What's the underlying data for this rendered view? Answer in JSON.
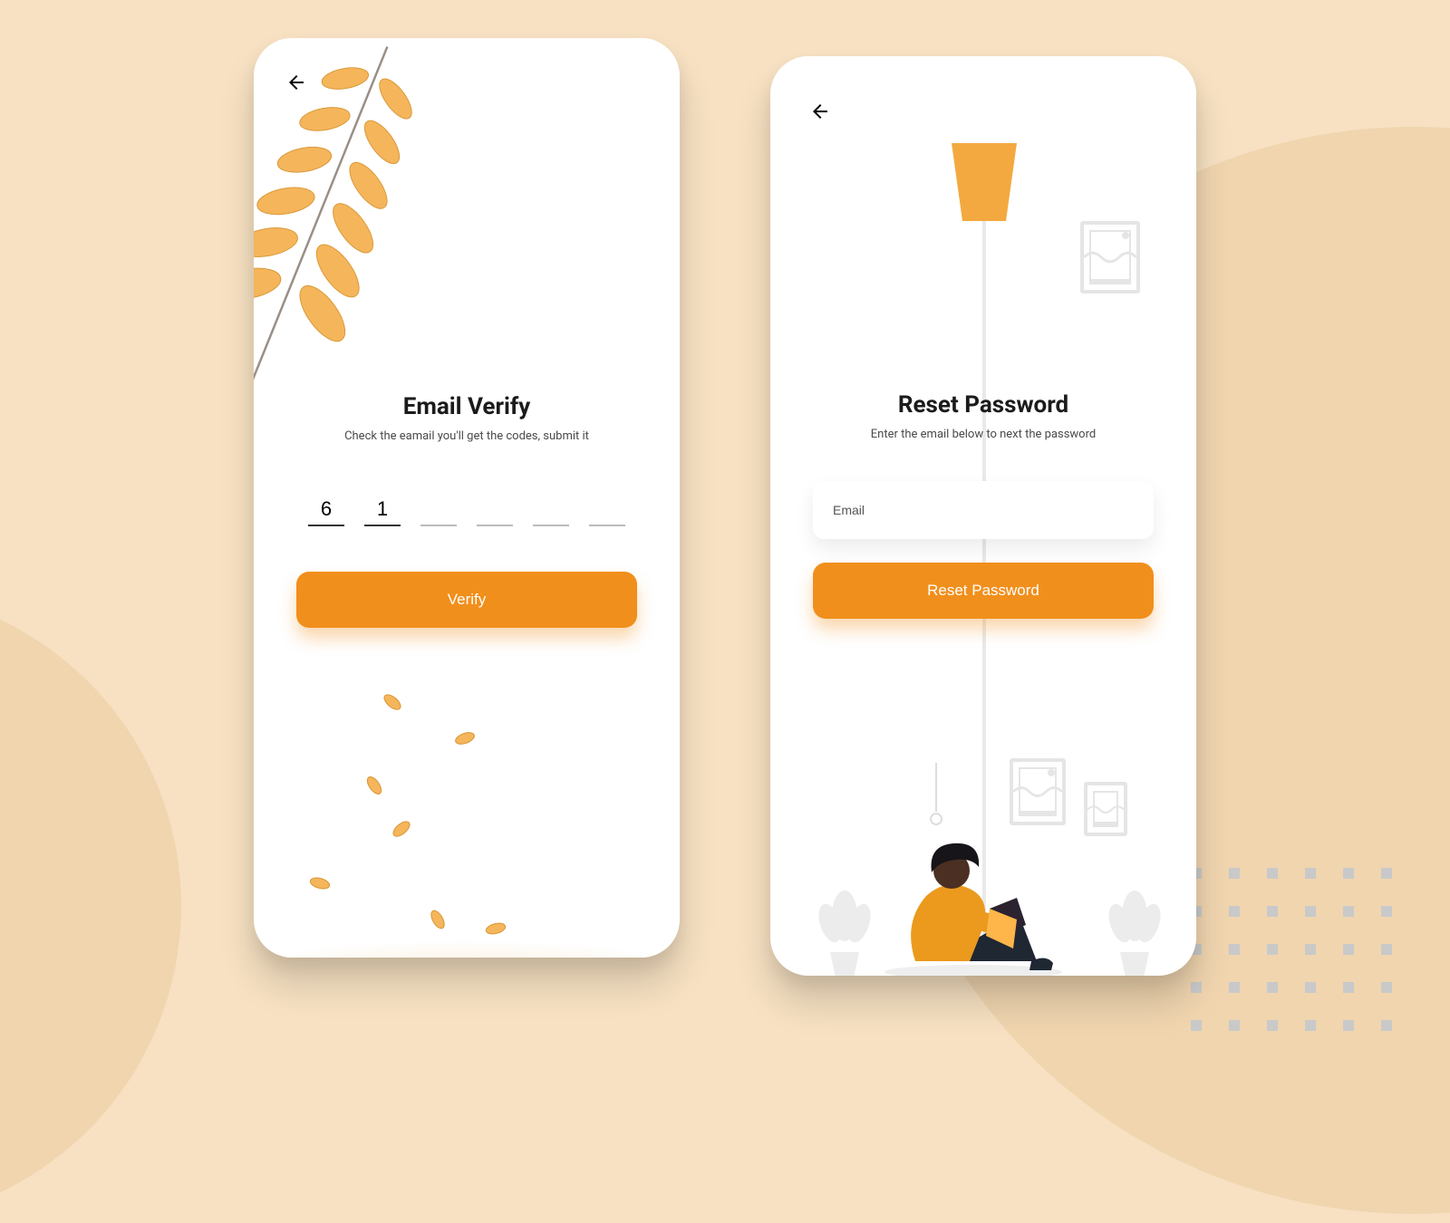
{
  "colors": {
    "accent": "#f18f1c",
    "leaf": "#f5b55b"
  },
  "screen1": {
    "title": "Email Verify",
    "subtitle": "Check the eamail you'll get the codes, submit it",
    "otp": [
      "6",
      "1",
      "",
      "",
      "",
      ""
    ],
    "button": "Verify"
  },
  "screen2": {
    "title": "Reset Password",
    "subtitle": "Enter the email below to next the password",
    "email_placeholder": "Email",
    "email_value": "",
    "button": "Reset Password"
  }
}
